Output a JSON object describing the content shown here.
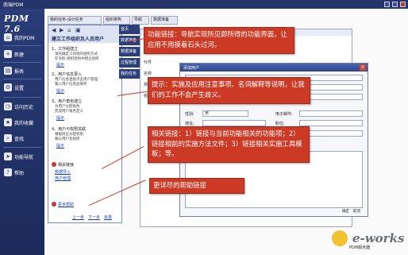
{
  "app": {
    "window_title": "南瑞PDM",
    "logo": "PDM 7.6"
  },
  "nav": [
    {
      "label": "我的PDM",
      "icon": "home-icon"
    },
    {
      "label": "新建",
      "icon": "new-document-icon"
    },
    {
      "label": "报表",
      "icon": "report-icon"
    },
    {
      "label": "设置",
      "icon": "gear-icon"
    },
    {
      "label": "访问历史",
      "icon": "history-icon"
    },
    {
      "label": "我的收藏",
      "icon": "star-icon"
    },
    {
      "label": "查找",
      "icon": "search-icon"
    },
    {
      "label": "功能导航",
      "icon": "navigation-icon"
    },
    {
      "label": "帮助",
      "icon": "help-icon"
    }
  ],
  "tabs": [
    "我的任务-设计任务",
    "组织架构",
    "导航",
    "数据准备"
  ],
  "strips": [
    "首页",
    "数据准备",
    "数据准备",
    "过程管理",
    "我的任务"
  ],
  "help": {
    "title": "建立工作组织及人员用户",
    "steps": [
      {
        "heading": "1、工作组建立",
        "sub1": "请先确定工作组的组织方式",
        "sub2": "在导航-组织结构中建立组织"
      },
      {
        "heading": "2、用户信息录入",
        "sub1": "用户信息直接点击用户管理",
        "sub2": "输入用户信息后保存"
      },
      {
        "heading": "3、用户角色建立",
        "sub1": "为用户分配角色",
        "sub2": "完成用户角色定义"
      },
      {
        "heading": "4、用户与权限关联",
        "sub1": "根据岗位分配权限",
        "sub2": "确认用户及组织"
      }
    ],
    "links": [
      "提示",
      "提示",
      "提示",
      "提示",
      "相关链接",
      "数据导入",
      "用户管理",
      "更多帮助"
    ],
    "footer_links": [
      "上一步",
      "下一步",
      "目录"
    ]
  },
  "bg_window": {
    "labels": [
      "代号",
      "名称",
      "类型",
      "组织"
    ]
  },
  "dialog": {
    "title": "添加用户",
    "labels": {
      "gender": "性别:",
      "phone": "电子邮件:",
      "address": "地址:",
      "position": "职位:"
    },
    "values": {
      "gender": "男",
      "workdir": "WORKDIR"
    },
    "buttons": [
      "确定",
      "取消"
    ]
  },
  "callouts": {
    "function_link": "功能链接：导航实现所见即所得的功能界面，让应用不用摸着石头过河。",
    "tips": "提示：实施及应用注意事项、名词解释等说明，让我们的工作不会产生歧义。",
    "related_links": "相关链接：1）链接与当前功能相关的功能项；2）链接相前的实施方法文件；3）链接相关实施工具模板；等。",
    "more_help": "更详尽的帮助链接"
  },
  "footer": {
    "status": "PDM服务器",
    "watermark": "e-works"
  },
  "colors": {
    "sidebar": "#25356b",
    "callout": "#cc3a26",
    "link": "#1a3fb8"
  }
}
